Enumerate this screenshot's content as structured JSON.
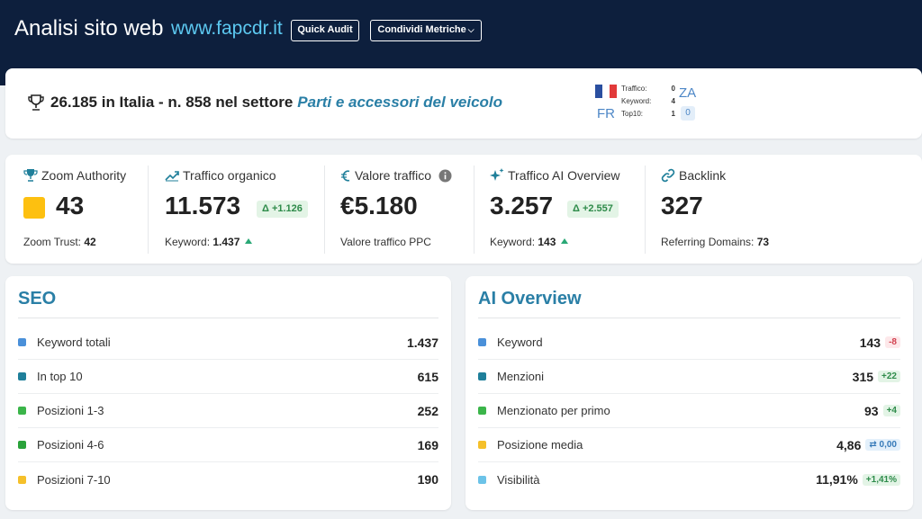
{
  "header": {
    "title": "Analisi sito web",
    "domain": "www.fapcdr.it",
    "quick_audit_label": "Quick Audit",
    "share_label": "Condividi Metriche"
  },
  "rank": {
    "text": "26.185 in Italia - n. 858 nel settore",
    "sector": "Parti e accessori del veicolo",
    "fr": {
      "code": "FR",
      "rows": [
        {
          "label": "Traffico:",
          "value": "0"
        },
        {
          "label": "Keyword:",
          "value": "4"
        },
        {
          "label": "Top10:",
          "value": "1"
        }
      ]
    },
    "za": {
      "code": "ZA",
      "badge": "0"
    }
  },
  "metrics": {
    "zoom_authority": {
      "title": "Zoom Authority",
      "value": "43",
      "sub_label": "Zoom Trust:",
      "sub_value": "42",
      "color": "#fdc010"
    },
    "organic": {
      "title": "Traffico organico",
      "value": "11.573",
      "delta": "Δ +1.126",
      "sub_label": "Keyword:",
      "sub_value": "1.437"
    },
    "traffic_value": {
      "title": "Valore traffico",
      "value": "€5.180",
      "sub_label": "Valore traffico PPC"
    },
    "ai_overview": {
      "title": "Traffico AI Overview",
      "value": "3.257",
      "delta": "Δ +2.557",
      "sub_label": "Keyword:",
      "sub_value": "143"
    },
    "backlink": {
      "title": "Backlink",
      "value": "327",
      "sub_label": "Referring Domains:",
      "sub_value": "73"
    }
  },
  "seo": {
    "title": "SEO",
    "rows": [
      {
        "label": "Keyword totali",
        "value": "1.437",
        "color": "#4a90d9"
      },
      {
        "label": "In top 10",
        "value": "615",
        "color": "#1f7f9a"
      },
      {
        "label": "Posizioni 1-3",
        "value": "252",
        "color": "#3bb54a"
      },
      {
        "label": "Posizioni 4-6",
        "value": "169",
        "color": "#2aa23a"
      },
      {
        "label": "Posizioni 7-10",
        "value": "190",
        "color": "#f5c02a"
      }
    ]
  },
  "ai": {
    "title": "AI Overview",
    "rows": [
      {
        "label": "Keyword",
        "value": "143",
        "badge": "-8",
        "badge_type": "neg",
        "color": "#4a90d9"
      },
      {
        "label": "Menzioni",
        "value": "315",
        "badge": "+22",
        "badge_type": "pos",
        "color": "#1f7f9a"
      },
      {
        "label": "Menzionato per primo",
        "value": "93",
        "badge": "+4",
        "badge_type": "pos",
        "color": "#3bb54a"
      },
      {
        "label": "Posizione media",
        "value": "4,86",
        "badge": "⇄ 0,00",
        "badge_type": "neu",
        "color": "#f5c02a"
      },
      {
        "label": "Visibilità",
        "value": "11,91%",
        "badge": "+1,41%",
        "badge_type": "pos",
        "color": "#6cc3e8"
      }
    ]
  }
}
